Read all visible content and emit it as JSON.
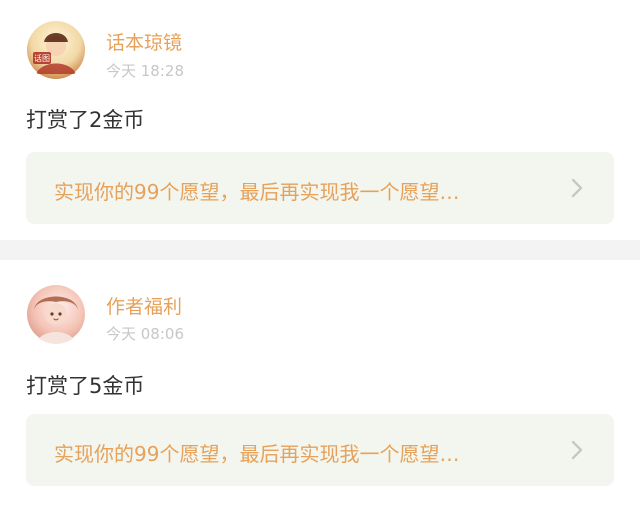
{
  "posts": [
    {
      "author": "话本琼镜",
      "time": "今天 18:28",
      "reward": "打赏了2金币",
      "wish": "实现你的99个愿望，最后再实现我一个愿望…",
      "avatar_badge": "话图"
    },
    {
      "author": "作者福利",
      "time": "今天 08:06",
      "reward": "打赏了5金币",
      "wish": "实现你的99个愿望，最后再实现我一个愿望…"
    }
  ],
  "colors": {
    "accent": "#e6a15a",
    "muted": "#c7c7c7",
    "body_text": "#333333",
    "wish_bg": "#f3f6ee"
  },
  "icons": {
    "chevron": "chevron-right-icon"
  }
}
